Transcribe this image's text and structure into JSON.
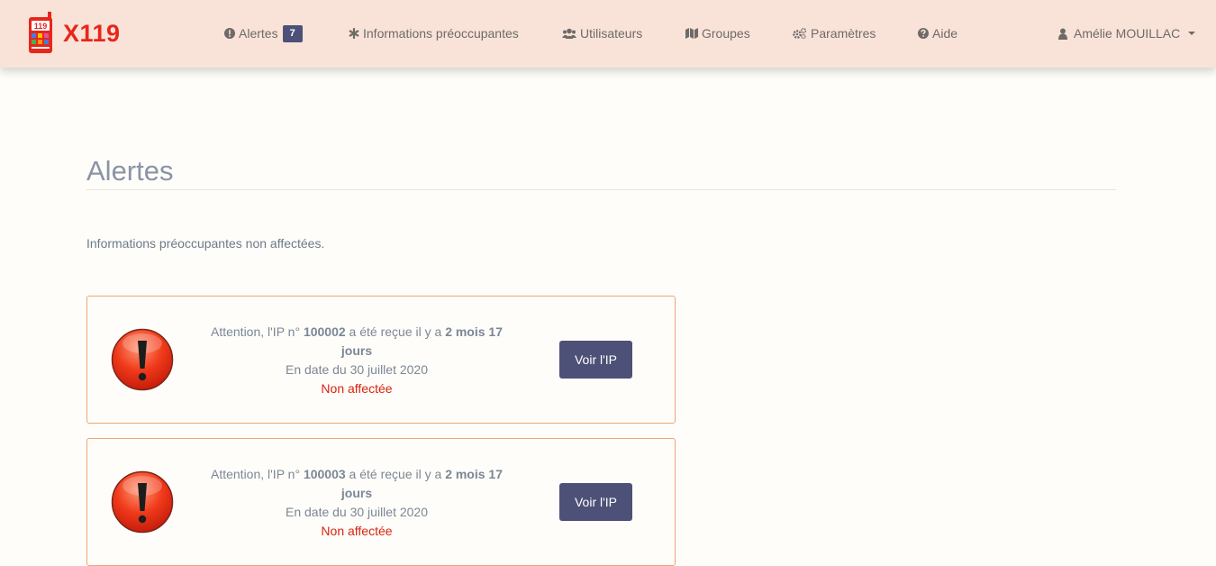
{
  "brand": {
    "name": "X119",
    "logo_text": "119",
    "color": "#e8261b"
  },
  "nav": {
    "alertes_label": "Alertes",
    "alertes_count": "7",
    "informations_label": "Informations préoccupantes",
    "utilisateurs_label": "Utilisateurs",
    "groupes_label": "Groupes",
    "parametres_label": "Paramètres",
    "aide_label": "Aide",
    "user_name": "Amélie MOUILLAC"
  },
  "page": {
    "title": "Alertes",
    "subtitle": "Informations préoccupantes non affectées."
  },
  "alerts": [
    {
      "prefix": "Attention, l'IP n° ",
      "ip_number": "100002",
      "middle": " a été reçue il y a ",
      "duration": "2 mois 17 jours",
      "date_text": "En date du 30 juillet 2020",
      "status": "Non affectée",
      "button_label": "Voir l'IP"
    },
    {
      "prefix": "Attention, l'IP n° ",
      "ip_number": "100003",
      "middle": " a été reçue il y a ",
      "duration": "2 mois 17 jours",
      "date_text": "En date du 30 juillet 2020",
      "status": "Non affectée",
      "button_label": "Voir l'IP"
    }
  ],
  "colors": {
    "navbar_bg": "#f9e3d8",
    "accent": "#4e5177",
    "card_border": "#f0a577",
    "status_red": "#d9230f"
  },
  "icons": [
    "info-circle-icon",
    "asterisk-icon",
    "users-icon",
    "map-icon",
    "gears-icon",
    "question-circle-icon",
    "user-icon",
    "caret-down-icon",
    "exclamation-alert-icon"
  ]
}
